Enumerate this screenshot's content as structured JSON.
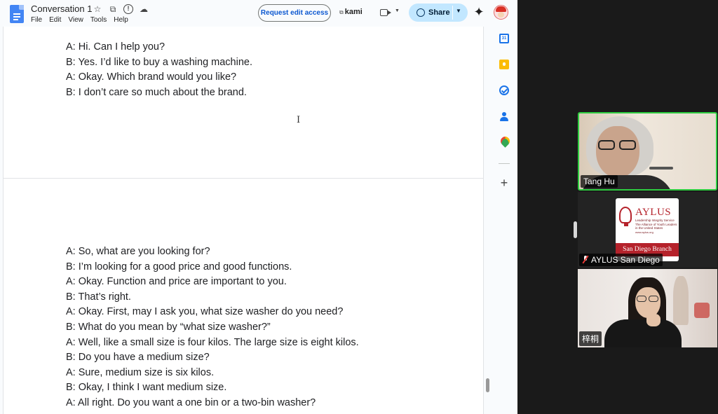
{
  "docs": {
    "title": "Conversation 1",
    "menu": [
      "File",
      "Edit",
      "View",
      "Tools",
      "Help"
    ],
    "request_edit_label": "Request edit access",
    "kami_label": "kami",
    "share_label": "Share"
  },
  "page1_lines": [
    "A: Hi. Can I help you?",
    "B: Yes. I’d like to buy a washing machine.",
    "A: Okay. Which brand would you like?",
    "B: I don’t care so much about the brand."
  ],
  "page2_lines": [
    "A: So, what are you looking for?",
    "B: I’m looking for a good price and good functions.",
    "A: Okay. Function and price are important to you.",
    "B: That’s right.",
    "A: Okay. First, may I ask you, what size washer do you need?",
    "B: What do you mean by “what size washer?”",
    "A: Well, like a small size is four kilos. The large size is eight kilos.",
    "B: Do you have a medium size?",
    "A: Sure, medium size is six kilos.",
    "B: Okay, I think I want medium size.",
    "A: All right. Do you want a one bin or a two-bin washer?"
  ],
  "meeting": {
    "participants": [
      {
        "name": "Tang Hu",
        "muted": false,
        "active_speaker": true
      },
      {
        "name": "AYLUS San Diego",
        "muted": true,
        "active_speaker": false
      },
      {
        "name": "梓桐",
        "muted": false,
        "active_speaker": false
      }
    ],
    "logo": {
      "title": "AYLUS",
      "subtitle": "Leadership Integrity Service The Alliance of Youth Leaders in the United States",
      "url": "www.aylus.org",
      "branch": "San Diego Branch"
    }
  },
  "colors": {
    "accent": "#0b57d0",
    "share_bg": "#c2e7ff",
    "active_speaker": "#2ecc40",
    "aylus_red": "#b5222b"
  }
}
